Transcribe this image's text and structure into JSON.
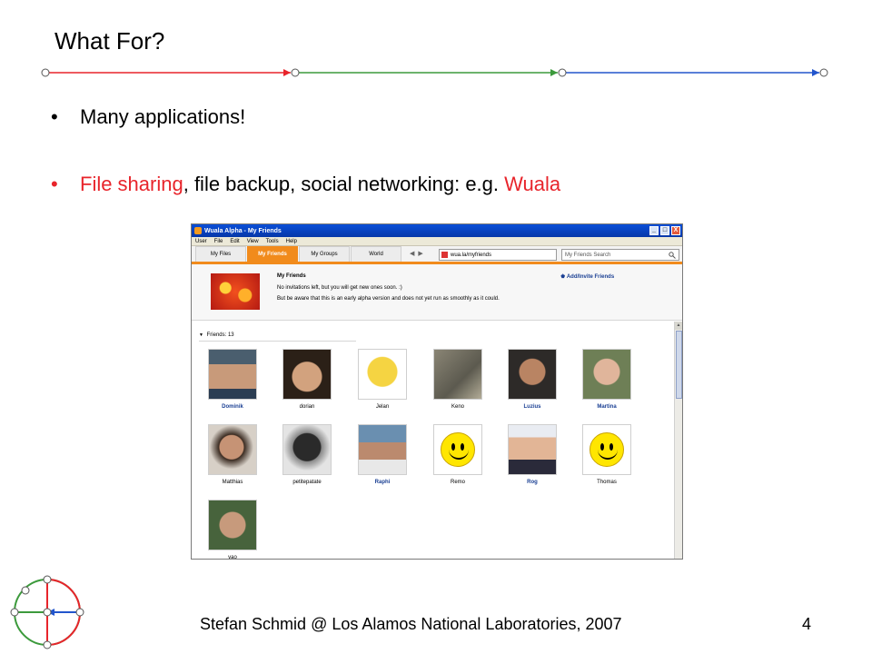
{
  "slide": {
    "title": "What For?",
    "bullets": [
      {
        "text": "Many applications!"
      },
      {
        "prefix_red": "File sharing",
        "middle": ", file backup, social networking: e.g. ",
        "suffix_red": "Wuala"
      }
    ],
    "bullet_glyph": "•",
    "footer": "Stefan Schmid @ Los Alamos National Laboratories, 2007",
    "page_number": "4",
    "rule_colors": [
      "#e8242b",
      "#3c9a3c",
      "#2255cc"
    ]
  },
  "app": {
    "window_title": "Wuala Alpha - My Friends",
    "window_buttons": [
      "_",
      "□",
      "X"
    ],
    "menu": [
      "User",
      "File",
      "Edit",
      "View",
      "Tools",
      "Help"
    ],
    "tabs": [
      "My Files",
      "My Friends",
      "My Groups",
      "World"
    ],
    "active_tab": "My Friends",
    "nav_back": "◀",
    "nav_forward": "▶",
    "address": "wua.la/myfriends",
    "search_placeholder": "My Friends Search",
    "search_icon": "magnifier-icon",
    "info": {
      "heading": "My Friends",
      "line1": "No invitations left, but you will get new ones soon. :)",
      "line2": "But be aware that this is an early alpha version and does not yet run as smoothly as it could.",
      "invite_label": "Add/Invite Friends"
    },
    "friends_header": "Friends: 13",
    "friends": [
      {
        "name": "Dominik",
        "link": true
      },
      {
        "name": "dorian",
        "link": false
      },
      {
        "name": "Jelan",
        "link": false
      },
      {
        "name": "Keno",
        "link": false
      },
      {
        "name": "Luzius",
        "link": true
      },
      {
        "name": "Martina",
        "link": true
      },
      {
        "name": "Matthias",
        "link": false
      },
      {
        "name": "petitepatate",
        "link": false
      },
      {
        "name": "Raphi",
        "link": true
      },
      {
        "name": "Remo",
        "link": false
      },
      {
        "name": "Rog",
        "link": true
      },
      {
        "name": "Thomas",
        "link": false
      },
      {
        "name": "yao",
        "link": false
      }
    ]
  }
}
